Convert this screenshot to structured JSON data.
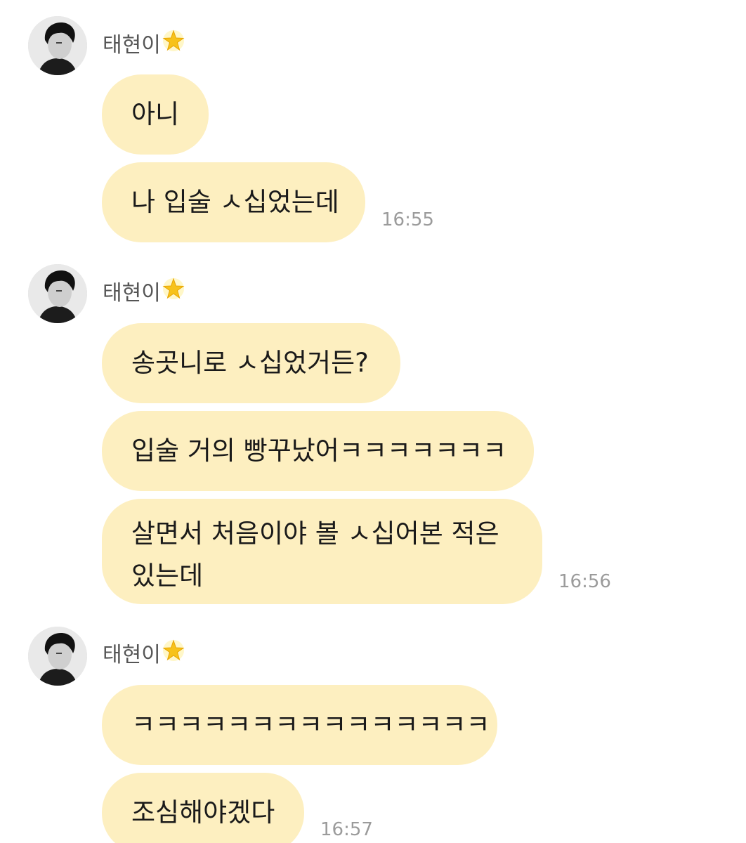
{
  "groups": [
    {
      "sender": "태현이",
      "messages": [
        "아니",
        "나 입술 ㅅ십었는데"
      ],
      "time": "16:55"
    },
    {
      "sender": "태현이",
      "messages": [
        "송곳니로 ㅅ십었거든?",
        "입술 거의 빵꾸났어ㅋㅋㅋㅋㅋㅋㅋ",
        "살면서 처음이야 볼 ㅅ십어본 적은\n있는데"
      ],
      "time": "16:56"
    },
    {
      "sender": "태현이",
      "messages": [
        "ㅋㅋㅋㅋㅋㅋㅋㅋㅋㅋㅋㅋㅋㅋㅋ",
        "조심해야겠다"
      ],
      "time": "16:57"
    }
  ],
  "icons": {
    "avatar": "profile-photo",
    "sender_badge": "glowing-star-icon"
  },
  "colors": {
    "bubble": "#fdefc0",
    "text": "#1a1a1a",
    "sender": "#555555",
    "time": "#9b9b9b",
    "background": "#ffffff"
  }
}
